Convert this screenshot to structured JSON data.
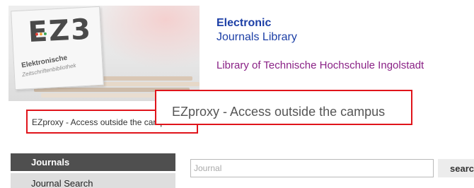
{
  "header": {
    "logo": {
      "mark": "EZ3",
      "word1": "Elektronische",
      "word2": "Zeitschriftenbibliothek",
      "dot_colors": [
        "#e03a2f",
        "#f0a43a",
        "#3aa655"
      ]
    },
    "title_line1": "Electronic",
    "title_line2": "Journals Library",
    "library_name": "Library of Technische Hochschule Ingolstadt"
  },
  "access": {
    "selected": "EZproxy - Access outside the campus",
    "callout": "EZproxy - Access outside the campus",
    "highlight_color": "#e0141b"
  },
  "nav": {
    "header": "Journals",
    "items": [
      "Journal Search"
    ]
  },
  "search": {
    "placeholder": "Journal",
    "button_label": "search"
  },
  "colors": {
    "title": "#1c3fa6",
    "library": "#8a2286",
    "nav_header_bg": "#4f4f4f"
  }
}
